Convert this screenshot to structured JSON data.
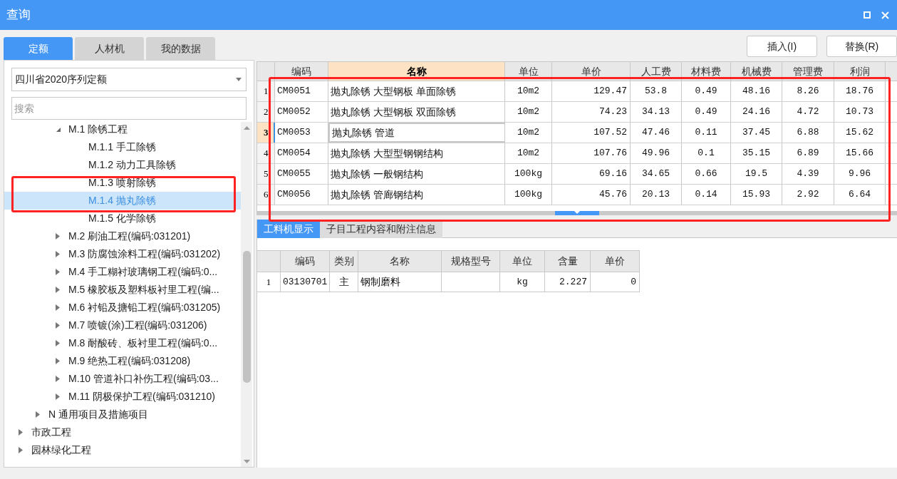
{
  "window": {
    "title": "查询"
  },
  "tabs": [
    {
      "label": "定额",
      "selected": true
    },
    {
      "label": "人材机",
      "selected": false
    },
    {
      "label": "我的数据",
      "selected": false
    }
  ],
  "library_select": {
    "value": "四川省2020序列定额"
  },
  "search": {
    "placeholder": "搜索"
  },
  "tree": [
    {
      "children": [
        {
          "children": [
            {
              "label": "M.1 除锈工程",
              "expanded": true,
              "children": [
                {
                  "label": "M.1.1 手工除锈",
                  "selected": false
                },
                {
                  "label": "M.1.2 动力工具除锈",
                  "selected": false
                },
                {
                  "label": "M.1.3 喷射除锈",
                  "selected": false
                },
                {
                  "label": "M.1.4 抛丸除锈",
                  "selected": true
                },
                {
                  "label": "M.1.5 化学除锈",
                  "selected": false
                }
              ]
            },
            {
              "label": "M.2 刷油工程(编码:031201)",
              "expanded": false,
              "selected": false
            },
            {
              "label": "M.3 防腐蚀涂料工程(编码:031202)",
              "expanded": false,
              "selected": false
            },
            {
              "label": "M.4 手工糊衬玻璃钢工程(编码:0...",
              "expanded": false,
              "selected": false
            },
            {
              "label": "M.5 橡胶板及塑料板衬里工程(编...",
              "expanded": false,
              "selected": false
            },
            {
              "label": "M.6 衬铅及搪铅工程(编码:031205)",
              "expanded": false,
              "selected": false
            },
            {
              "label": "M.7 喷镀(涂)工程(编码:031206)",
              "expanded": false,
              "selected": false
            },
            {
              "label": "M.8 耐酸砖、板衬里工程(编码:0...",
              "expanded": false,
              "selected": false
            },
            {
              "label": "M.9 绝热工程(编码:031208)",
              "expanded": false,
              "selected": false
            },
            {
              "label": "M.10 管道补口补伤工程(编码:03...",
              "expanded": false,
              "selected": false
            },
            {
              "label": "M.11 阴极保护工程(编码:031210)",
              "expanded": false,
              "selected": false
            }
          ]
        },
        {
          "label": "N 通用项目及措施项目",
          "expanded": false,
          "selected": false
        }
      ]
    },
    {
      "label": "市政工程",
      "expanded": false,
      "selected": false
    },
    {
      "label": "园林绿化工程",
      "expanded": false,
      "selected": false
    }
  ],
  "buttons": [
    "插入(I)",
    "替换(R)"
  ],
  "quota_table": {
    "columns": [
      {
        "label": "编码",
        "selected": false
      },
      {
        "label": "名称",
        "selected": true
      },
      {
        "label": "单位",
        "selected": false
      },
      {
        "label": "单价",
        "selected": false
      },
      {
        "label": "人工费",
        "selected": false
      },
      {
        "label": "材料费",
        "selected": false
      },
      {
        "label": "机械费",
        "selected": false
      },
      {
        "label": "管理费",
        "selected": false
      },
      {
        "label": "利润",
        "selected": false
      }
    ],
    "rows": [
      {
        "index": "1",
        "selected": false,
        "cells": [
          "CM0051",
          "抛丸除锈 大型钢板 单面除锈",
          "10m2",
          "129.47",
          "53.8",
          "0.49",
          "48.16",
          "8.26",
          "18.76"
        ]
      },
      {
        "index": "2",
        "selected": false,
        "cells": [
          "CM0052",
          "抛丸除锈 大型钢板 双面除锈",
          "10m2",
          "74.23",
          "34.13",
          "0.49",
          "24.16",
          "4.72",
          "10.73"
        ]
      },
      {
        "index": "3",
        "selected": true,
        "cells": [
          "CM0053",
          "抛丸除锈 管道",
          "10m2",
          "107.52",
          "47.46",
          "0.11",
          "37.45",
          "6.88",
          "15.62"
        ]
      },
      {
        "index": "4",
        "selected": false,
        "cells": [
          "CM0054",
          "抛丸除锈 大型型钢钢结构",
          "10m2",
          "107.76",
          "49.96",
          "0.1",
          "35.15",
          "6.89",
          "15.66"
        ]
      },
      {
        "index": "5",
        "selected": false,
        "cells": [
          "CM0055",
          "抛丸除锈 一般钢结构",
          "100kg",
          "69.16",
          "34.65",
          "0.66",
          "19.5",
          "4.39",
          "9.96"
        ]
      },
      {
        "index": "6",
        "selected": false,
        "cells": [
          "CM0056",
          "抛丸除锈 管廊钢结构",
          "100kg",
          "45.76",
          "20.13",
          "0.14",
          "15.93",
          "2.92",
          "6.64"
        ]
      }
    ]
  },
  "detail_tabs": [
    {
      "label": "工料机显示",
      "selected": true
    },
    {
      "label": "子目工程内容和附注信息",
      "selected": false
    }
  ],
  "resource_table": {
    "columns": [
      "编码",
      "类别",
      "名称",
      "规格型号",
      "单位",
      "含量",
      "单价"
    ],
    "rows": [
      {
        "index": "1",
        "cells": [
          "03130701",
          "主",
          "钢制磨料",
          "",
          "kg",
          "2.227",
          "0"
        ]
      }
    ]
  }
}
